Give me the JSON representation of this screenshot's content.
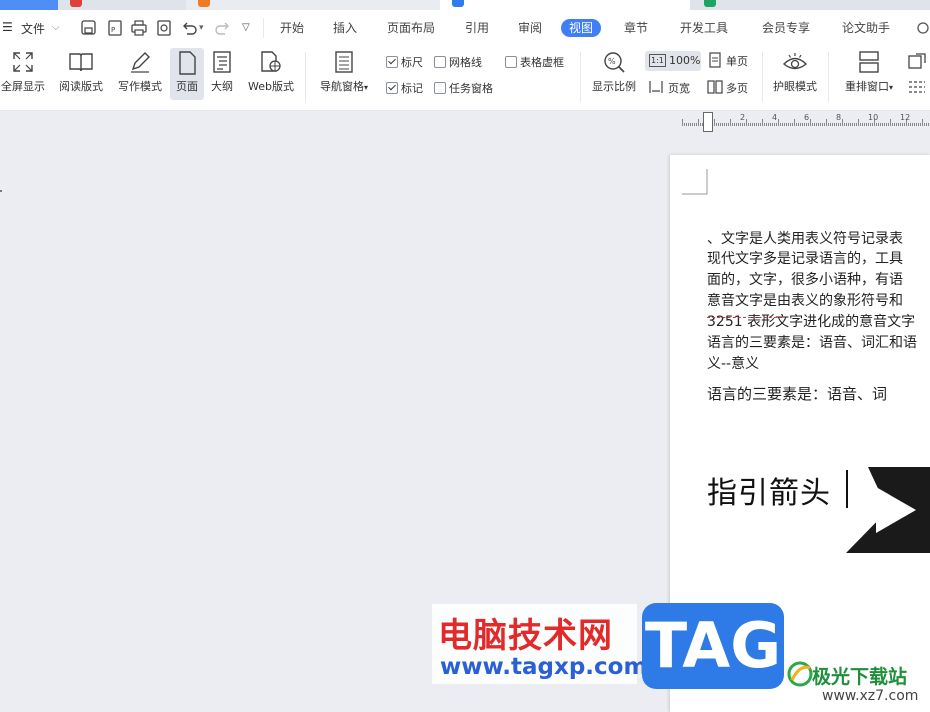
{
  "menu": {
    "file": "文件",
    "tabs": [
      "开始",
      "插入",
      "页面布局",
      "引用",
      "审阅",
      "视图",
      "章节",
      "开发工具",
      "会员专享",
      "论文助手"
    ],
    "active_tab": "视图"
  },
  "ribbon": {
    "fullscreen": "全屏显示",
    "reading_layout": "阅读版式",
    "writing_mode": "写作模式",
    "page": "页面",
    "outline": "大纲",
    "web_layout": "Web版式",
    "nav_pane": "导航窗格",
    "ruler": "标尺",
    "gridlines": "网格线",
    "table_gridlines": "表格虚框",
    "marks": "标记",
    "task_pane": "任务窗格",
    "zoom": "显示比例",
    "zoom_100": "100%",
    "page_width": "页宽",
    "single_page": "单页",
    "multi_page": "多页",
    "eye_protection": "护眼模式",
    "rearrange_window": "重排窗口"
  },
  "ruler": {
    "numbers": [
      "2",
      "4",
      "6",
      "8",
      "10",
      "12"
    ]
  },
  "document": {
    "lines": [
      "、文字是人类用表义符号记录表",
      "现代文字多是记录语言的，工具",
      "面的，文字，很多小语种，有语",
      "意音文字是由表义的象形符号和",
      "3251 表形文字进化成的意音文字",
      "语言的三要素是：语音、词汇和语",
      "义--意义"
    ],
    "serif_line": "语言的三要素是：语音、词",
    "heading": "指引箭头"
  },
  "watermark": {
    "title": "电脑技术网",
    "url": "www.tagxp.com",
    "tag": "TAG",
    "site2_title": "极光下载站",
    "site2_url": "www.xz7.com"
  },
  "colors": {
    "accent": "#3f7ef5",
    "watermark_red": "#e22a2a",
    "watermark_blue": "#2e7be8"
  }
}
